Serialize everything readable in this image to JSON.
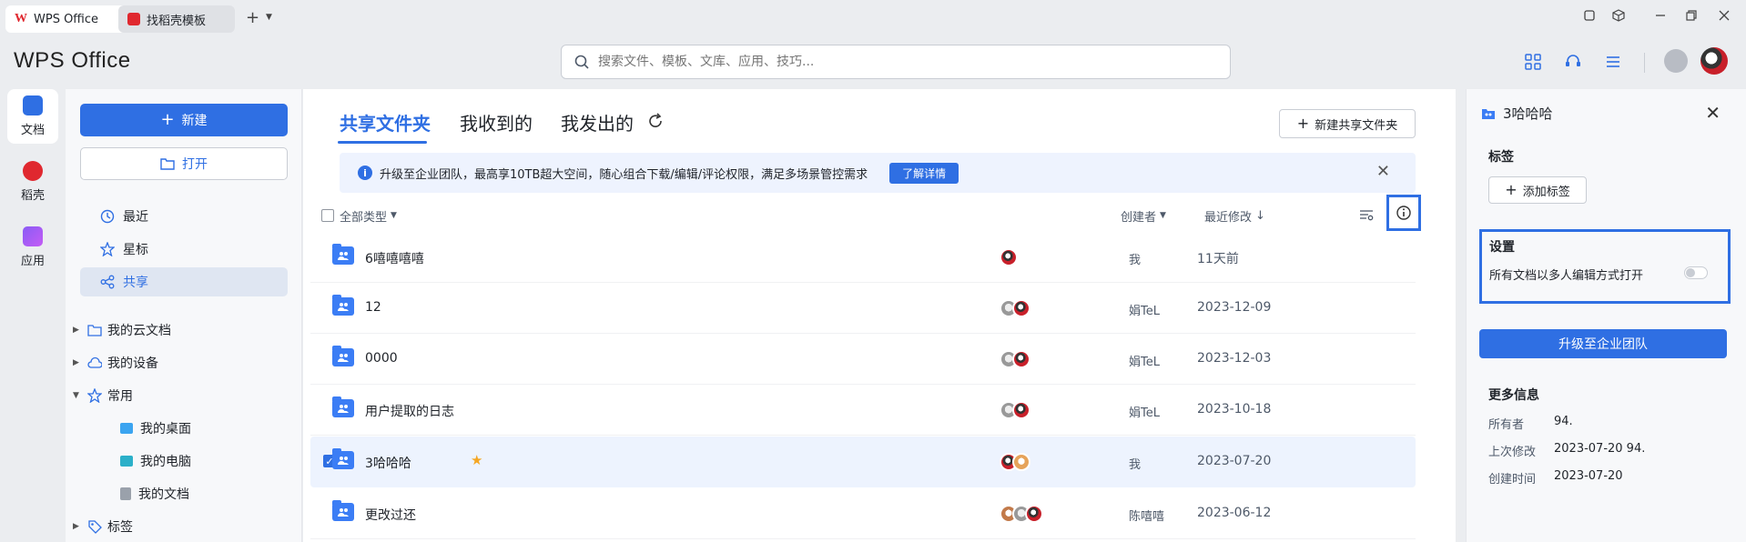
{
  "tabs": [
    {
      "label": "WPS Office"
    },
    {
      "label": "找稻壳模板"
    }
  ],
  "brand": "WPS Office",
  "search": {
    "placeholder": "搜索文件、模板、文库、应用、技巧..."
  },
  "rail": [
    {
      "label": "文档"
    },
    {
      "label": "稻壳"
    },
    {
      "label": "应用"
    }
  ],
  "sidebar": {
    "new_label": "新建",
    "open_label": "打开",
    "nav": [
      {
        "label": "最近"
      },
      {
        "label": "星标"
      },
      {
        "label": "共享"
      }
    ],
    "tree": [
      {
        "label": "我的云文档"
      },
      {
        "label": "我的设备"
      },
      {
        "label": "常用"
      },
      {
        "label": "标签"
      }
    ],
    "sub": [
      {
        "label": "我的桌面"
      },
      {
        "label": "我的电脑"
      },
      {
        "label": "我的文档"
      }
    ]
  },
  "main": {
    "tabs": [
      {
        "label": "共享文件夹"
      },
      {
        "label": "我收到的"
      },
      {
        "label": "我发出的"
      }
    ],
    "new_shared_label": "新建共享文件夹",
    "banner": {
      "text": "升级至企业团队，最高享10TB超大空间，随心组合下载/编辑/评论权限，满足多场景管控需求",
      "button": "了解详情"
    },
    "columns": {
      "type": "全部类型",
      "creator": "创建者",
      "modified": "最近修改"
    },
    "rows": [
      {
        "name": "6嘻嘻嘻嘻",
        "creator": "我",
        "date": "11天前",
        "avatars": 1
      },
      {
        "name": "12",
        "creator": "娟TeL",
        "date": "2023-12-09",
        "avatars": 2
      },
      {
        "name": "0000",
        "creator": "娟TeL",
        "date": "2023-12-03",
        "avatars": 2
      },
      {
        "name": "用户提取的日志",
        "creator": "娟TeL",
        "date": "2023-10-18",
        "avatars": 2
      },
      {
        "name": "3哈哈哈",
        "creator": "我",
        "date": "2023-07-20",
        "avatars": 2
      },
      {
        "name": "更改过还",
        "creator": "陈嘻嘻",
        "date": "2023-06-12",
        "avatars": 3
      }
    ]
  },
  "panel": {
    "title": "3哈哈哈",
    "tags_heading": "标签",
    "add_tag_label": "添加标签",
    "settings_heading": "设置",
    "settings_option": "所有文档以多人编辑方式打开",
    "multi_edit_enabled": false,
    "upgrade_label": "升级至企业团队",
    "more_heading": "更多信息",
    "info": [
      {
        "key": "所有者",
        "value": "94."
      },
      {
        "key": "上次修改",
        "value": "2023-07-20 94."
      },
      {
        "key": "创建时间",
        "value": "2023-07-20"
      }
    ]
  },
  "colors": {
    "accent": "#2f6fe3",
    "folder": "#3b7df5",
    "star": "#f5a623",
    "brand_red": "#e0282f"
  }
}
